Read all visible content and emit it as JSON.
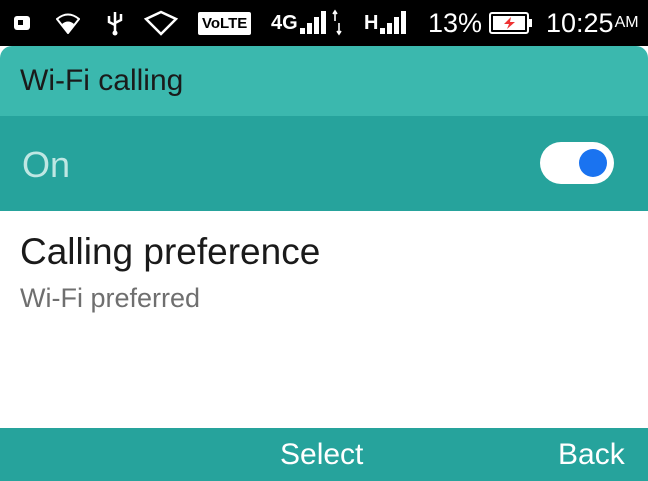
{
  "status_bar": {
    "icons": [
      "notification-icon",
      "wifi-icon",
      "usb-icon",
      "shield-icon"
    ],
    "volte": "VoLTE",
    "network_1": "4G",
    "network_2": "H",
    "battery_percent": "13%",
    "battery_icon": "battery-charging-icon",
    "time": "10:25",
    "ampm": "AM"
  },
  "header": {
    "title": "Wi-Fi calling"
  },
  "toggle": {
    "label": "On",
    "state": "on",
    "knob_color": "#1a73f0"
  },
  "preference": {
    "title": "Calling preference",
    "value": "Wi-Fi preferred"
  },
  "softkeys": {
    "center": "Select",
    "right": "Back"
  },
  "colors": {
    "header": "#3bb8ae",
    "accent": "#26a39c",
    "status_bar": "#000000"
  }
}
